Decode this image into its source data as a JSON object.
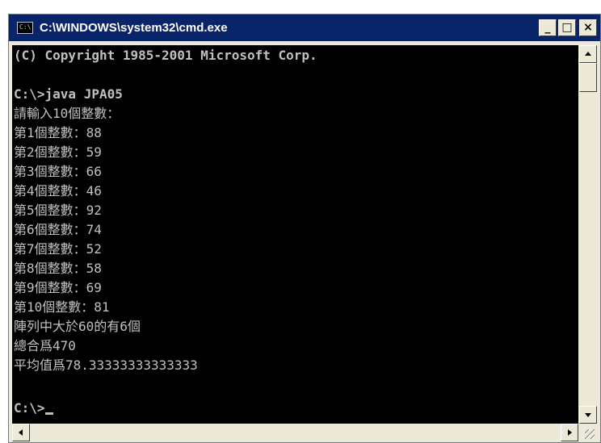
{
  "window": {
    "title": "C:\\WINDOWS\\system32\\cmd.exe",
    "icon_label": "C:\\",
    "buttons": {
      "minimize": "_",
      "maximize": "□",
      "close": "×"
    }
  },
  "console": {
    "lines": [
      "(C) Copyright 1985-2001 Microsoft Corp.",
      "",
      "C:\\>java JPA05",
      "請輸入10個整數：",
      "第1個整數：88",
      "第2個整數：59",
      "第3個整數：66",
      "第4個整數：46",
      "第5個整數：92",
      "第6個整數：74",
      "第7個整數：52",
      "第8個整數：58",
      "第9個整數：69",
      "第10個整數：81",
      "陣列中大於60的有6個",
      "總合爲470",
      "平均值爲78.33333333333333",
      "",
      "C:\\>"
    ]
  },
  "colors": {
    "console_background": "#000000",
    "console_text": "#c0c0c0",
    "title_bar": "#0a246a",
    "window_frame": "#ece9d8"
  },
  "icons": [
    "cmd-icon",
    "minimize-icon",
    "maximize-icon",
    "close-icon",
    "scroll-up-icon",
    "scroll-down-icon",
    "scroll-left-icon",
    "scroll-right-icon",
    "resize-grip-icon"
  ]
}
